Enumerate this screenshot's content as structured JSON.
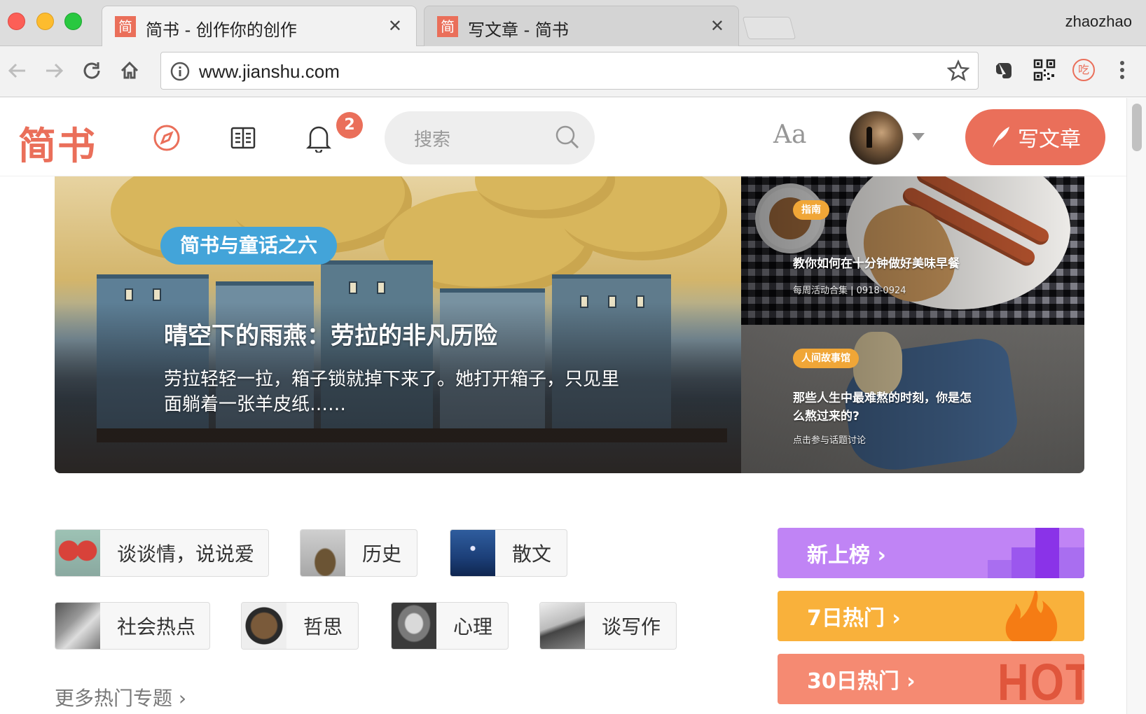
{
  "browser": {
    "tabs": [
      {
        "favicon": "简",
        "title": "简书 - 创作你的创作",
        "active": true
      },
      {
        "favicon": "简",
        "title": "写文章 - 简书",
        "active": false
      }
    ],
    "profile_name": "zhaozhao",
    "url": "www.jianshu.com",
    "extension_badge": "吃"
  },
  "header": {
    "logo": "简书",
    "notifications_count": "2",
    "search_placeholder": "搜索",
    "font_toggle": "Aa",
    "write_button": "写文章",
    "accent_color": "#ea6f5a"
  },
  "banner": {
    "main": {
      "tag": "简书与童话之六",
      "title": "晴空下的雨燕：劳拉的非凡历险",
      "desc": "劳拉轻轻一拉，箱子锁就掉下来了。她打开箱子，只见里面躺着一张羊皮纸……"
    },
    "side": [
      {
        "tag": "指南",
        "title": "教你如何在十分钟做好美味早餐",
        "sub": "每周活动合集 | 0918-0924"
      },
      {
        "tag": "人间故事馆",
        "title": "那些人生中最难熬的时刻，你是怎么熬过来的?",
        "sub": "点击参与话题讨论"
      }
    ]
  },
  "topics": [
    {
      "label": "谈谈情，说说爱"
    },
    {
      "label": "历史"
    },
    {
      "label": "散文"
    },
    {
      "label": "社会热点"
    },
    {
      "label": "哲思"
    },
    {
      "label": "心理"
    },
    {
      "label": "谈写作"
    }
  ],
  "more_topics": "更多热门专题 ›",
  "boards": [
    {
      "label": "新上榜 ›",
      "color": "#c084f5"
    },
    {
      "label": "7日热门 ›",
      "color": "#f9b13b"
    },
    {
      "label": "30日热门 ›",
      "color": "#f58a72",
      "watermark": "HOT"
    }
  ]
}
